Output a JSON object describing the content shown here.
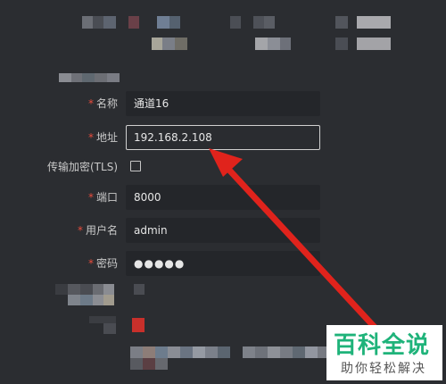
{
  "form": {
    "name": {
      "label": "名称",
      "value": "通道16"
    },
    "address": {
      "label": "地址",
      "value": "192.168.2.108"
    },
    "tls": {
      "label": "传输加密(TLS)",
      "checked": false
    },
    "port": {
      "label": "端口",
      "value": "8000"
    },
    "username": {
      "label": "用户名",
      "value": "admin"
    },
    "password": {
      "label": "密码",
      "value": "●●●●●"
    },
    "required_mark": "*"
  },
  "watermark": {
    "title": "百科全说",
    "subtitle": "助你轻松解决"
  },
  "colors": {
    "background": "#2b2d31",
    "input_bg": "#24262a",
    "required": "#e74c3c",
    "arrow": "#e0231c",
    "watermark_green": "#1fb37a"
  },
  "icons": {
    "annotation_arrow": "red-arrow-icon"
  }
}
